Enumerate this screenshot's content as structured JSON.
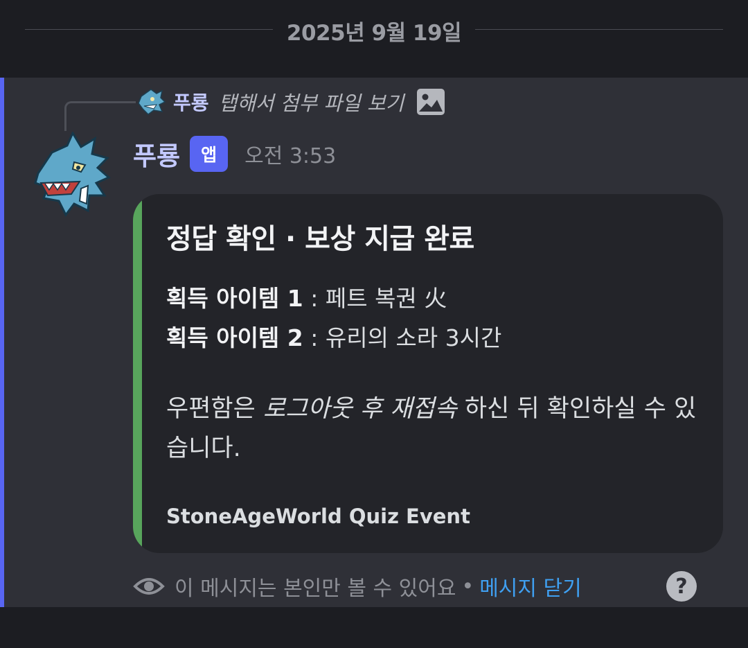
{
  "date_divider": {
    "label": "2025년 9월 19일"
  },
  "reply": {
    "author": "푸룡",
    "text": "탭해서 첨부 파일 보기",
    "icon": "image-icon"
  },
  "message": {
    "author": "푸룡",
    "badge": "앱",
    "timestamp": "오전 3:53"
  },
  "embed": {
    "title": "정답 확인 · 보상 지급 완료",
    "items": [
      {
        "label": "획득 아이템 1",
        "sep": " : ",
        "value": "페트 복권 火"
      },
      {
        "label": "획득 아이템 2",
        "sep": " : ",
        "value": "유리의 소라 3시간"
      }
    ],
    "body_prefix": "우편함은 ",
    "body_emphasis": "로그아웃 후 재접속",
    "body_suffix": " 하신 뒤 확인하실 수 있습니다.",
    "footer": "StoneAgeWorld Quiz Event",
    "accent_color": "#58a55c"
  },
  "ephemeral": {
    "notice": "이 메시지는 본인만 볼 수 있어요",
    "separator": "•",
    "dismiss": "메시지 닫기",
    "help": "?"
  },
  "colors": {
    "brand": "#5865f2",
    "link": "#3fa0f2",
    "background": "#2f3037"
  }
}
